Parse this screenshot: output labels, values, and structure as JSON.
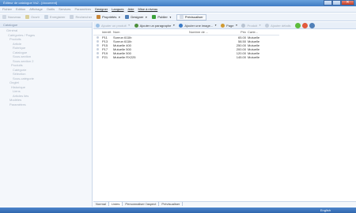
{
  "window": {
    "title": "Éditeur de catalogue Vs2 - [document]"
  },
  "menu": {
    "items": [
      {
        "label": "Fichier",
        "enabled": false
      },
      {
        "label": "Edition",
        "enabled": false
      },
      {
        "label": "Affichage",
        "enabled": false
      },
      {
        "label": "Outils",
        "enabled": false
      },
      {
        "label": "Services",
        "enabled": false
      },
      {
        "label": "Paramètres",
        "enabled": false
      },
      {
        "label": "Designer",
        "enabled": true
      },
      {
        "label": "Langues",
        "enabled": true
      },
      {
        "label": "Aide",
        "enabled": true
      },
      {
        "label": "Mise à niveau",
        "enabled": true
      }
    ]
  },
  "toolbar": {
    "items": [
      {
        "label": "Nouveau",
        "enabled": false,
        "color": "#cfd7e2"
      },
      {
        "label": "Ouvrir",
        "enabled": false,
        "color": "#d9cf9b"
      },
      {
        "label": "Enregistrer",
        "enabled": false,
        "color": "#c5d1e0"
      },
      {
        "label": "Rechercher",
        "enabled": false,
        "color": "#cad3df"
      },
      {
        "label": "Propriétés",
        "enabled": true,
        "color": "#c8873a"
      },
      {
        "label": "Designer",
        "enabled": true,
        "color": "#4f7fb8"
      },
      {
        "label": "Publier",
        "enabled": true,
        "color": "#3aa13a"
      },
      {
        "label": "Prévisualiser",
        "enabled": true,
        "color": "#d6dde7"
      }
    ]
  },
  "sidebar": {
    "header": "Catalogue",
    "tree": [
      "Général",
      "Catégories / Pages",
      "Produits",
      "Article",
      "Rubrique",
      "Catalogue",
      "Sous-section",
      "Sous-section 2",
      "Produits",
      "Catégorie",
      "Sélection",
      "Sous-catégorie",
      "Onglet",
      "Historique",
      "Liens",
      "Articles liés",
      "Modèles",
      "Paramètres"
    ]
  },
  "subtoolbar": {
    "items": [
      {
        "label": "Ajouter un produit",
        "dim": true,
        "color": "#9bc0e6"
      },
      {
        "label": "Ajouter un paragraphe",
        "dim": false,
        "color": "#4c8f3c"
      },
      {
        "label": "Ajouter une image...",
        "dim": false,
        "color": "#3a7ac6"
      },
      {
        "label": "Page",
        "dim": false,
        "color": "#d09a32"
      },
      {
        "label": "Produit",
        "dim": true,
        "color": "#b9c4d2"
      },
      {
        "label": "Ajouter détails",
        "dim": true,
        "color": "#c3cdda"
      }
    ],
    "icons": [
      "#5cbc3c",
      "#e25a3c",
      "#4f7fb8"
    ]
  },
  "table": {
    "columns": [
      "Identif.",
      "Nom",
      "Nombre de ...",
      "Prix",
      "Carte..."
    ],
    "rows": [
      {
        "id": "P11",
        "nom": "Sunrun 611lb",
        "num": "",
        "prix": "65.00",
        "carte": "Mutuelle"
      },
      {
        "id": "P13",
        "nom": "Sunrun 611lb",
        "num": "",
        "prix": "58.50",
        "carte": "Mutuelle"
      },
      {
        "id": "P15",
        "nom": "Mutuelle 400",
        "num": "",
        "prix": "250.00",
        "carte": "Mutuelle"
      },
      {
        "id": "P17",
        "nom": "Mutuelle 500",
        "num": "",
        "prix": "200.00",
        "carte": "Mutuelle"
      },
      {
        "id": "P19",
        "nom": "Mutuelle 500",
        "num": "",
        "prix": "120.00",
        "carte": "Mutuelle"
      },
      {
        "id": "P21",
        "nom": "Mutuelle RX225",
        "num": "",
        "prix": "145.00",
        "carte": "Mutuelle"
      }
    ]
  },
  "tabs": [
    "Normal",
    "Listes",
    "Personnaliser l'aspect",
    "Prévisualiser"
  ],
  "status": {
    "language": "English"
  }
}
